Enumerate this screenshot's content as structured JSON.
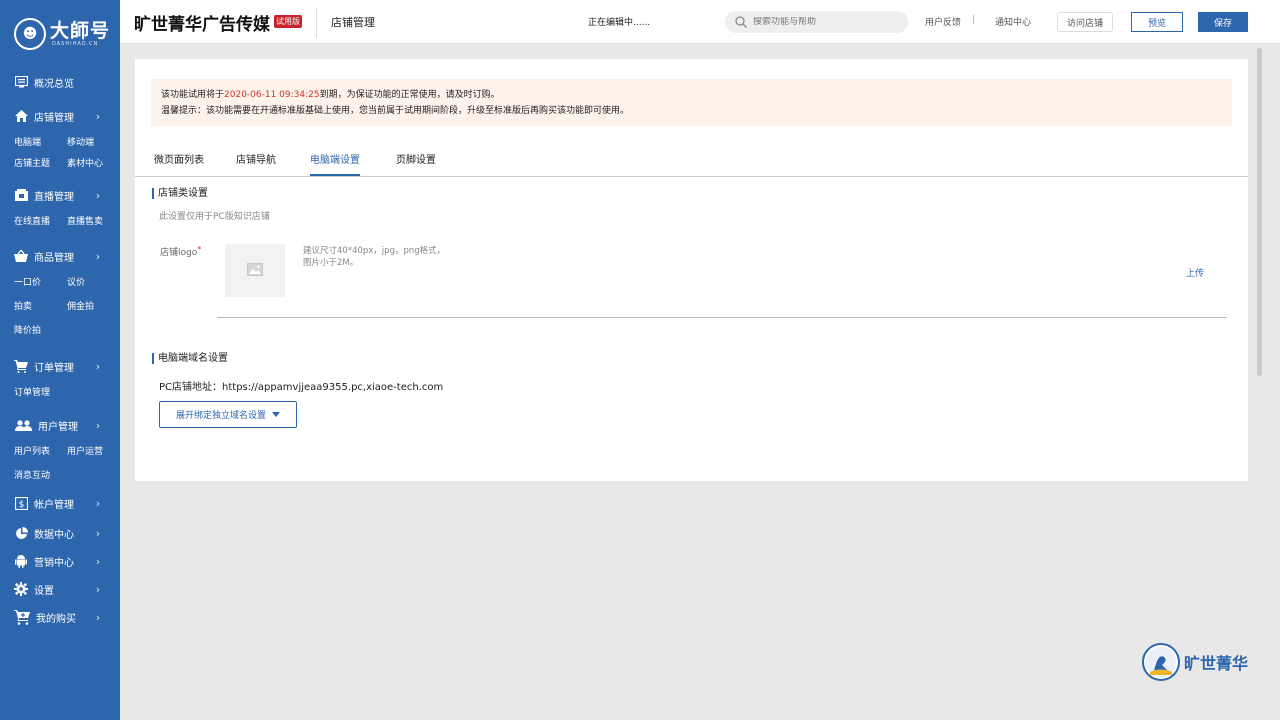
{
  "sidebar": {
    "logo_main": "大師号",
    "logo_sub": "DASHIHAO.CN",
    "groups": [
      {
        "label": "概况总览",
        "icon": "overview-icon",
        "has_arrow": false,
        "subs": []
      },
      {
        "label": "店铺管理",
        "icon": "home-icon",
        "has_arrow": true,
        "subs": [
          "电脑端",
          "移动端",
          "店铺主题",
          "素材中心"
        ]
      },
      {
        "label": "直播管理",
        "icon": "live-icon",
        "has_arrow": true,
        "subs": [
          "在线直播",
          "直播售卖"
        ]
      },
      {
        "label": "商品管理",
        "icon": "basket-icon",
        "has_arrow": true,
        "subs": [
          "一口价",
          "议价",
          "拍卖",
          "佣金拍",
          "降价拍"
        ]
      },
      {
        "label": "订单管理",
        "icon": "cart-icon",
        "has_arrow": true,
        "subs": [
          "订单管理"
        ]
      },
      {
        "label": "用户管理",
        "icon": "users-icon",
        "has_arrow": true,
        "subs": [
          "用户列表",
          "用户运营",
          "消息互动"
        ]
      },
      {
        "label": "帐户管理",
        "icon": "dollar-icon",
        "has_arrow": true,
        "subs": []
      },
      {
        "label": "数据中心",
        "icon": "pie-chart-icon",
        "has_arrow": true,
        "subs": []
      },
      {
        "label": "营销中心",
        "icon": "android-icon",
        "has_arrow": true,
        "subs": []
      },
      {
        "label": "设置",
        "icon": "gear-icon",
        "has_arrow": true,
        "subs": []
      },
      {
        "label": "我的购买",
        "icon": "shopping-cart-icon",
        "has_arrow": true,
        "subs": []
      }
    ]
  },
  "header": {
    "brand": "旷世菁华广告传媒",
    "trial_badge": "试用版",
    "section": "店铺管理",
    "editing_status": "正在编辑中......",
    "search_placeholder": "搜索功能与帮助",
    "feedback": "用户反馈",
    "separator": "|",
    "notifications": "通知中心",
    "visit_store": "访问店铺",
    "preview": "预览",
    "save": "保存"
  },
  "notice": {
    "line1_prefix": "该功能试用将于",
    "line1_date": "2020-06-11 09:34:25",
    "line1_suffix": "到期，为保证功能的正常使用，请及时订购。",
    "line2": "温馨提示：该功能需要在开通标准版基础上使用，您当前属于试用期间阶段，升级至标准版后再购买该功能即可使用。"
  },
  "tabs": [
    "微页面列表",
    "店铺导航",
    "电脑端设置",
    "页脚设置"
  ],
  "store_settings": {
    "title": "店铺类设置",
    "hint": "此设置仅用于PC版知识店铺",
    "logo_label": "店铺logo",
    "required_mark": "*",
    "upload_tip_line1": "建议尺寸40*40px，jpg，png格式，",
    "upload_tip_line2": "图片小于2M。",
    "upload_link": "上传"
  },
  "domain_settings": {
    "title": "电脑端域名设置",
    "address_label": "PC店铺地址：",
    "address_value": "https://appamvjjeaa9355.pc,xiaoe-tech.com",
    "expand_button": "展开绑定独立域名设置"
  },
  "watermark": {
    "text": "旷世菁华"
  },
  "colors": {
    "primary": "#2e66ad",
    "danger": "#d0342c",
    "notice_bg": "#fdf3eb"
  }
}
